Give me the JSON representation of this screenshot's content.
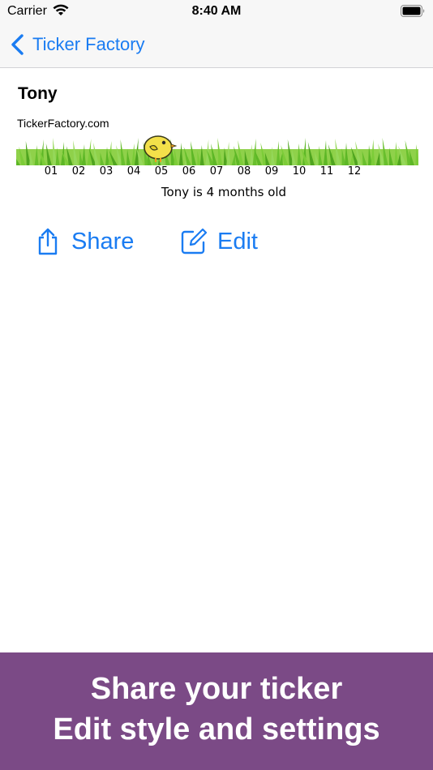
{
  "status_bar": {
    "carrier": "Carrier",
    "time": "8:40 AM",
    "wifi_icon": "wifi-icon",
    "battery_icon": "battery-full-icon"
  },
  "nav": {
    "back_label": "Ticker Factory",
    "back_icon": "chevron-left-icon"
  },
  "ticker": {
    "title": "Tony",
    "site": "TickerFactory.com",
    "months": [
      "01",
      "02",
      "03",
      "04",
      "05",
      "06",
      "07",
      "08",
      "09",
      "10",
      "11",
      "12"
    ],
    "current_month": "05",
    "caption": "Tony is 4 months old",
    "marker_icon": "chick-icon"
  },
  "actions": {
    "share_label": "Share",
    "edit_label": "Edit"
  },
  "promo": {
    "line1": "Share your ticker",
    "line2": "Edit style and settings"
  },
  "colors": {
    "accent": "#1a7cf2",
    "banner": "#7b4a86",
    "grass": "#6cc22e"
  }
}
